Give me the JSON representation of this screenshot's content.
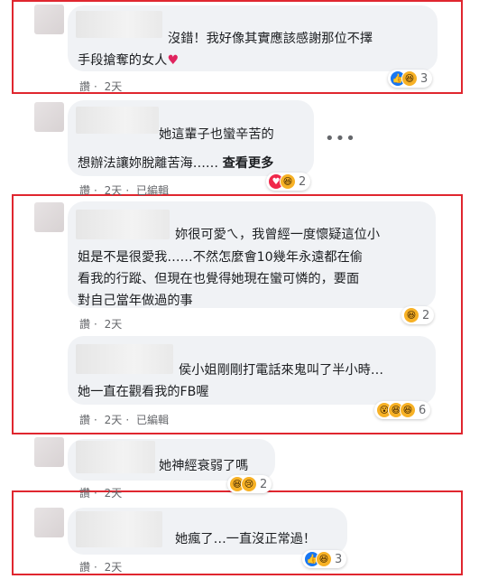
{
  "comments": [
    {
      "lines": [
        "沒錯！我好像其實應該感謝那位不擇",
        "手段搶奪的女人"
      ],
      "heart": "♥",
      "meta": [
        "讚",
        "2天"
      ],
      "reaction_count": "3"
    },
    {
      "lines": [
        "她這輩子也蠻辛苦的",
        "想辦法讓妳脫離苦海……"
      ],
      "see_more": "查看更多",
      "meta": [
        "讚",
        "2天",
        "已編輯"
      ],
      "reaction_count": "2"
    },
    {
      "lines": [
        "妳很可愛ㄟ，我曾經一度懷疑這位小",
        "姐是不是很愛我……不然怎麼會10幾年永遠都在偷",
        "看我的行蹤、但現在也覺得她現在蠻可憐的，要面",
        "對自己當年做過的事"
      ],
      "meta": [
        "讚",
        "2天"
      ],
      "reaction_count": "2"
    },
    {
      "lines": [
        "侯小姐剛剛打電話來鬼叫了半小時…",
        "她一直在觀看我的FB喔"
      ],
      "meta": [
        "讚",
        "2天",
        "已編輯"
      ],
      "reaction_count": "6"
    },
    {
      "lines": [
        "她神經衰弱了嗎"
      ],
      "meta": [
        "讚",
        "2天"
      ],
      "reaction_count": "2"
    },
    {
      "lines": [
        "她瘋了…一直沒正常過！"
      ],
      "meta": [
        "讚",
        "2天"
      ],
      "reaction_count": "3"
    }
  ],
  "more_options": "•••",
  "colors": {
    "highlight_box": "#e0262f",
    "bubble": "#f0f2f5",
    "like": "#1877f2",
    "love": "#f0284a",
    "haha": "#f7b125"
  },
  "icons": [
    "like-icon",
    "haha-icon",
    "love-icon",
    "wow-icon",
    "sad-icon",
    "heart-icon",
    "more-options-icon"
  ]
}
